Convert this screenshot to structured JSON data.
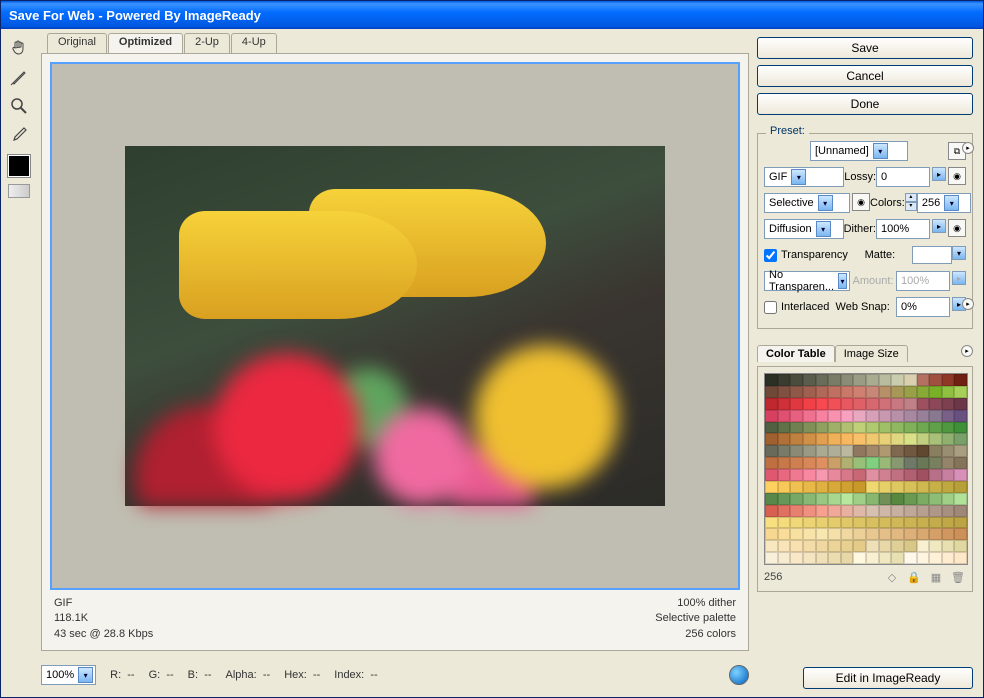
{
  "window": {
    "title": "Save For Web - Powered By ImageReady"
  },
  "tabs": {
    "original": "Original",
    "optimized": "Optimized",
    "twoup": "2-Up",
    "fourup": "4-Up"
  },
  "info": {
    "format": "GIF",
    "size": "118.1K",
    "timing": "43 sec @ 28.8 Kbps",
    "dither": "100% dither",
    "palette": "Selective palette",
    "colors": "256 colors"
  },
  "bottom": {
    "zoom": "100%",
    "r": "R:",
    "g": "G:",
    "b": "B:",
    "alpha": "Alpha:",
    "hex": "Hex:",
    "index": "Index:",
    "r_v": "--",
    "g_v": "--",
    "b_v": "--",
    "alpha_v": "--",
    "hex_v": "--",
    "index_v": "--",
    "edit": "Edit in ImageReady"
  },
  "buttons": {
    "save": "Save",
    "cancel": "Cancel",
    "done": "Done"
  },
  "settings": {
    "preset_label": "Preset:",
    "preset_value": "[Unnamed]",
    "format": "GIF",
    "lossy_label": "Lossy:",
    "lossy_value": "0",
    "reduction": "Selective",
    "colors_label": "Colors:",
    "colors_value": "256",
    "dither_type": "Diffusion",
    "dither_label": "Dither:",
    "dither_value": "100%",
    "transparency": "Transparency",
    "matte_label": "Matte:",
    "trans_dither": "No Transparen...",
    "amount_label": "Amount:",
    "amount_value": "100%",
    "interlaced": "Interlaced",
    "websnap_label": "Web Snap:",
    "websnap_value": "0%"
  },
  "colortable": {
    "tab1": "Color Table",
    "tab2": "Image Size",
    "count": "256",
    "colors": [
      "#2c2f24",
      "#3a3c30",
      "#4a4c3e",
      "#5a5c4c",
      "#6a6c5a",
      "#7a7c68",
      "#8a8c76",
      "#9a9c84",
      "#aaac92",
      "#babc9f",
      "#cacdad",
      "#dad0b0",
      "#b47060",
      "#a05040",
      "#903828",
      "#702010",
      "#704838",
      "#805040",
      "#905848",
      "#a06050",
      "#b06858",
      "#c07060",
      "#ca7868",
      "#d08070",
      "#c88878",
      "#b89068",
      "#a89858",
      "#98a048",
      "#88a838",
      "#78b028",
      "#90c040",
      "#a8d058",
      "#c02830",
      "#d03038",
      "#e03840",
      "#f04048",
      "#f84850",
      "#f05058",
      "#e85860",
      "#e06068",
      "#d86870",
      "#d07078",
      "#c87880",
      "#c08088",
      "#9c5060",
      "#8c4858",
      "#7c4050",
      "#6c3848",
      "#d84060",
      "#e05070",
      "#e86080",
      "#f07090",
      "#f880a0",
      "#f890b0",
      "#f8a0c0",
      "#e8a8c0",
      "#d8a0b8",
      "#c898b0",
      "#b890a8",
      "#a888a0",
      "#988098",
      "#887890",
      "#786088",
      "#685080",
      "#506040",
      "#607048",
      "#708050",
      "#809058",
      "#90a060",
      "#a0b068",
      "#b0c070",
      "#c0d078",
      "#b0c870",
      "#a0c068",
      "#90b860",
      "#80b058",
      "#70a850",
      "#60a048",
      "#509840",
      "#409038",
      "#a06030",
      "#b07038",
      "#c08040",
      "#d09048",
      "#e0a050",
      "#f0b058",
      "#f8b860",
      "#f8c068",
      "#f0c870",
      "#e8d078",
      "#e0d880",
      "#d8e088",
      "#c0d080",
      "#a8c078",
      "#90b070",
      "#78a068",
      "#6a6a5a",
      "#7a7a68",
      "#8a8a76",
      "#9a9a84",
      "#aaaa92",
      "#b0ae98",
      "#bcb8a0",
      "#907860",
      "#a08868",
      "#b09870",
      "#806850",
      "#705840",
      "#604830",
      "#8a7e60",
      "#9a8e70",
      "#aa9e80",
      "#c07040",
      "#c87848",
      "#d08050",
      "#d88858",
      "#e09060",
      "#c8a068",
      "#b0b070",
      "#98c078",
      "#80d080",
      "#9ab878",
      "#889870",
      "#707868",
      "#6a7858",
      "#788060",
      "#94846a",
      "#84745a",
      "#e05870",
      "#e86880",
      "#f07890",
      "#f888a0",
      "#f898b0",
      "#e8889c",
      "#d87888",
      "#c86874",
      "#e090a0",
      "#d08090",
      "#c07080",
      "#b06070",
      "#a05060",
      "#b87088",
      "#c880a0",
      "#d890b8",
      "#fed060",
      "#f8c858",
      "#f0c050",
      "#e8b848",
      "#e0b040",
      "#d8a838",
      "#d0a030",
      "#c89828",
      "#f0d870",
      "#e8d068",
      "#e0c860",
      "#d8c058",
      "#d0b850",
      "#c8b048",
      "#c0a840",
      "#b8a038",
      "#58884a",
      "#689858",
      "#78a866",
      "#88b874",
      "#98c882",
      "#a8d890",
      "#b8e89e",
      "#a0d088",
      "#88b870",
      "#709058",
      "#588840",
      "#6a9a52",
      "#7cac64",
      "#8ebe76",
      "#a0d088",
      "#b2e29a",
      "#d86050",
      "#e07060",
      "#e88070",
      "#f09080",
      "#f8a090",
      "#f0a898",
      "#e8b0a0",
      "#e0b8a8",
      "#d8c0b0",
      "#d0b8a8",
      "#c8b0a0",
      "#c0a898",
      "#b8a090",
      "#b09888",
      "#a89080",
      "#a08878",
      "#f8e080",
      "#f4dc7c",
      "#f0d878",
      "#ecd474",
      "#e8d070",
      "#e4cc6c",
      "#e0c868",
      "#dcc464",
      "#d8c060",
      "#d4bc5c",
      "#d0b858",
      "#ccb454",
      "#c8b050",
      "#c4ac4c",
      "#c0a848",
      "#bca444",
      "#f8d890",
      "#f8dc98",
      "#f8e0a0",
      "#f8e4a8",
      "#f8e8b0",
      "#f4e0a8",
      "#f0d8a0",
      "#ecd098",
      "#e8c890",
      "#e4c088",
      "#e0b880",
      "#dcb078",
      "#d8a870",
      "#d4a068",
      "#d09860",
      "#cc9058",
      "#f8e8c0",
      "#f8e4b8",
      "#f8e0b0",
      "#f4dca8",
      "#f0d8a0",
      "#ecd498",
      "#e8d090",
      "#e4cc88",
      "#f0e0b8",
      "#e8d8a8",
      "#e0d098",
      "#d8c888",
      "#f8f0d0",
      "#f0e8c0",
      "#e8e0b0",
      "#e0d8a0",
      "#f8f0d8",
      "#f8ecd0",
      "#f8e8c8",
      "#f4e4c0",
      "#f0e0b8",
      "#ecdcb0",
      "#e8d8a8",
      "#fef8e0",
      "#f8f0d0",
      "#f0e8c0",
      "#e8e0b0",
      "#fff8e8",
      "#fff4e0",
      "#fff0d8",
      "#ffecd0",
      "#ffe8c8"
    ]
  }
}
